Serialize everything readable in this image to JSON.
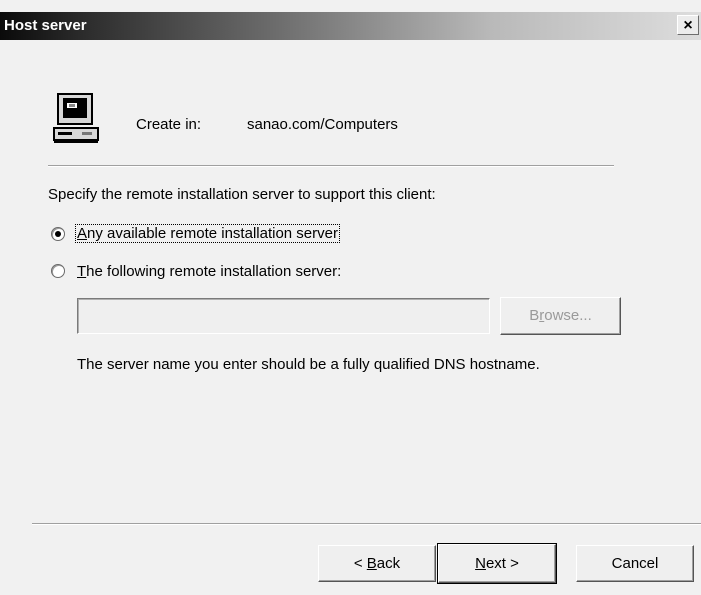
{
  "window": {
    "title": "Host server",
    "close_glyph": "×"
  },
  "header": {
    "icon": "computer-icon",
    "create_in_label": "Create in:",
    "create_in_value": "sanao.com/Computers"
  },
  "prompt": "Specify the remote installation server to support this client:",
  "options": [
    {
      "label": "Any available remote installation server",
      "mnemonic": "A",
      "rest": "ny available remote installation server",
      "selected": true
    },
    {
      "label": "The following remote installation server:",
      "mnemonic": "T",
      "rest": "he following remote installation server:",
      "selected": false
    }
  ],
  "server_input": {
    "value": "",
    "enabled": false
  },
  "browse_button": {
    "pre": "B",
    "mnemonic": "r",
    "post": "owse...",
    "enabled": false
  },
  "note": "The server name you enter should be a fully qualified DNS hostname.",
  "buttons": {
    "back": {
      "pre": "< ",
      "mnemonic": "B",
      "post": "ack"
    },
    "next": {
      "pre": "",
      "mnemonic": "N",
      "post": "ext >"
    },
    "cancel": "Cancel"
  }
}
